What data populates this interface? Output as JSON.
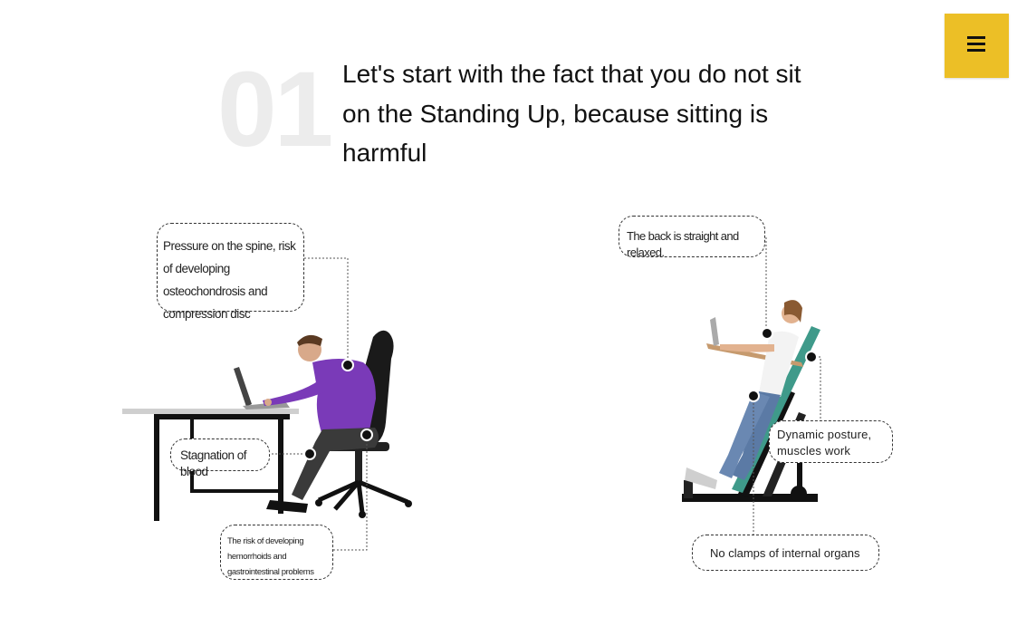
{
  "menu": {
    "icon": "hamburger-menu-icon",
    "accent_color": "#ecbf26"
  },
  "step": {
    "number": "01",
    "headline": "Let's start with the fact that you do not sit on the Standing Up, because sitting is harmful"
  },
  "sitting": {
    "callouts": {
      "spine": "Pressure on the spine, risk of developing osteochondrosis and compression disc",
      "blood": "Stagnation of blood",
      "hemorrhoids": "The risk of developing hemorrhoids and gastrointestinal problems"
    }
  },
  "standing": {
    "callouts": {
      "back": "The back is straight and relaxed.",
      "posture": "Dynamic posture, muscles work",
      "organs": "No clamps of internal organs"
    }
  }
}
